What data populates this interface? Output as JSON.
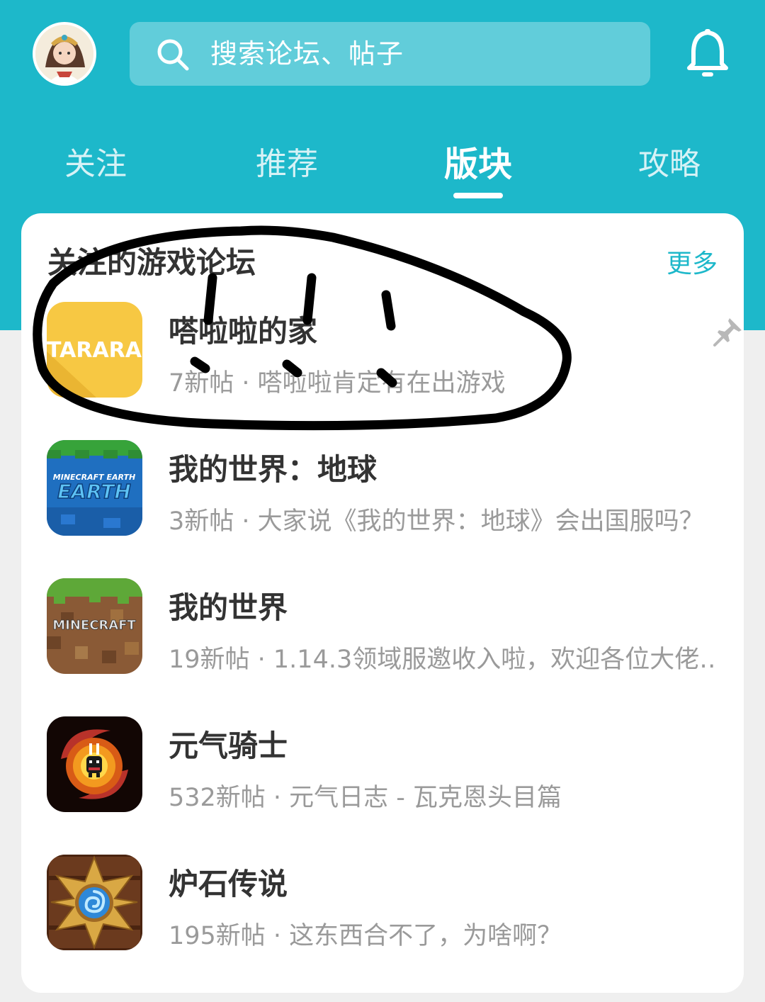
{
  "header": {
    "avatar_icon": "user-avatar",
    "search_placeholder": "搜索论坛、帖子",
    "search_icon": "search-icon",
    "notification_icon": "bell-icon",
    "brand_color": "#1db8ca"
  },
  "tabs": [
    {
      "label": "关注"
    },
    {
      "label": "推荐"
    },
    {
      "label": "版块",
      "active": true
    },
    {
      "label": "攻略"
    }
  ],
  "section": {
    "title": "关注的游戏论坛",
    "more_label": "更多"
  },
  "forums": [
    {
      "name": "嗒啦啦的家",
      "desc": "7新帖 · 嗒啦啦肯定有在出游戏",
      "icon": "tarara-icon",
      "icon_text": "TARARA",
      "pinned": true
    },
    {
      "name": "我的世界：地球",
      "desc": "3新帖 · 大家说《我的世界：地球》会出国服吗？",
      "icon": "minecraft-earth-icon",
      "icon_text": "MINECRAFT EARTH"
    },
    {
      "name": "我的世界",
      "desc": "19新帖 · 1.14.3领域服邀收入啦，欢迎各位大佬…",
      "icon": "minecraft-icon",
      "icon_text": "MINECRAFT"
    },
    {
      "name": "元气骑士",
      "desc": "532新帖 · 元气日志 - 瓦克恩头目篇",
      "icon": "soul-knight-icon"
    },
    {
      "name": "炉石传说",
      "desc": "195新帖 · 这东西合不了，为啥啊？",
      "icon": "hearthstone-icon"
    }
  ]
}
